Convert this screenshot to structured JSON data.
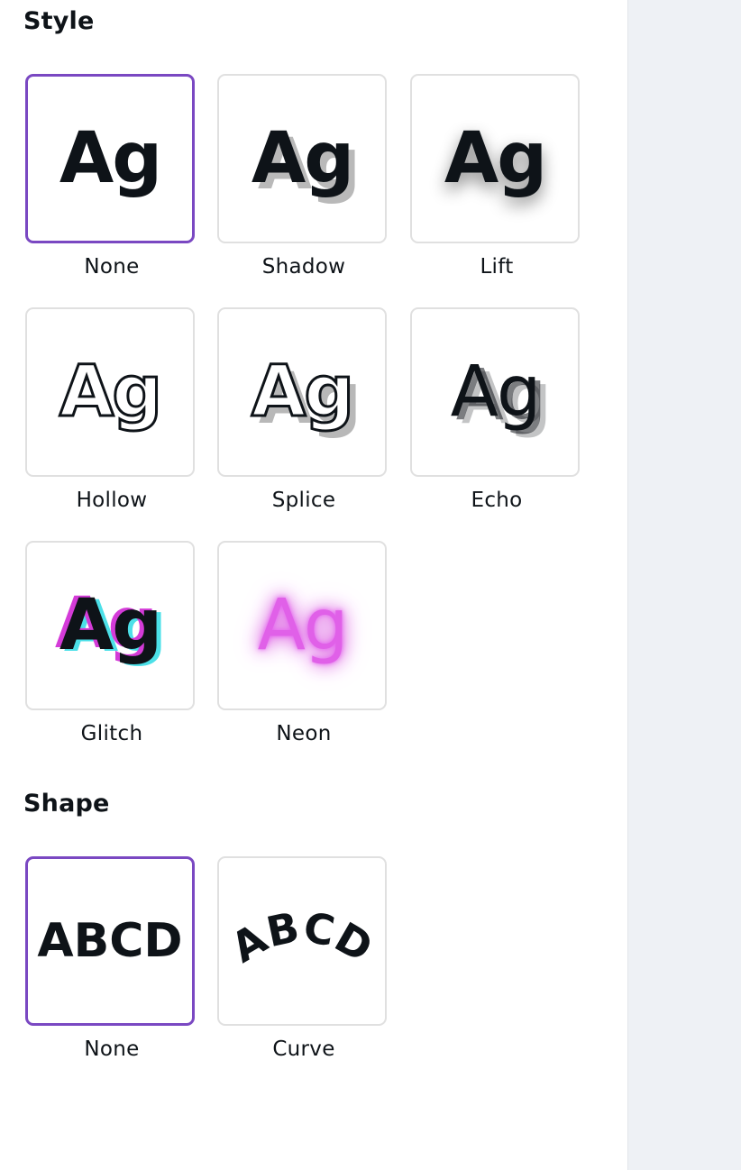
{
  "style_section": {
    "title": "Style",
    "preview_text": "Ag",
    "options": [
      {
        "label": "None",
        "effect": "none",
        "selected": true
      },
      {
        "label": "Shadow",
        "effect": "shadow",
        "selected": false
      },
      {
        "label": "Lift",
        "effect": "lift",
        "selected": false
      },
      {
        "label": "Hollow",
        "effect": "hollow",
        "selected": false
      },
      {
        "label": "Splice",
        "effect": "splice",
        "selected": false
      },
      {
        "label": "Echo",
        "effect": "echo",
        "selected": false
      },
      {
        "label": "Glitch",
        "effect": "glitch",
        "selected": false
      },
      {
        "label": "Neon",
        "effect": "neon",
        "selected": false
      }
    ]
  },
  "shape_section": {
    "title": "Shape",
    "preview_text": "ABCD",
    "options": [
      {
        "label": "None",
        "shape": "none",
        "selected": true
      },
      {
        "label": "Curve",
        "shape": "curve",
        "selected": false
      }
    ]
  },
  "colors": {
    "selected_border": "#7a48c2",
    "card_border": "#e0e0e0",
    "text": "#0e1318",
    "neon": "#d43bd8",
    "glitch_cyan": "#4ce0e8",
    "side_strip": "#eef1f5"
  }
}
